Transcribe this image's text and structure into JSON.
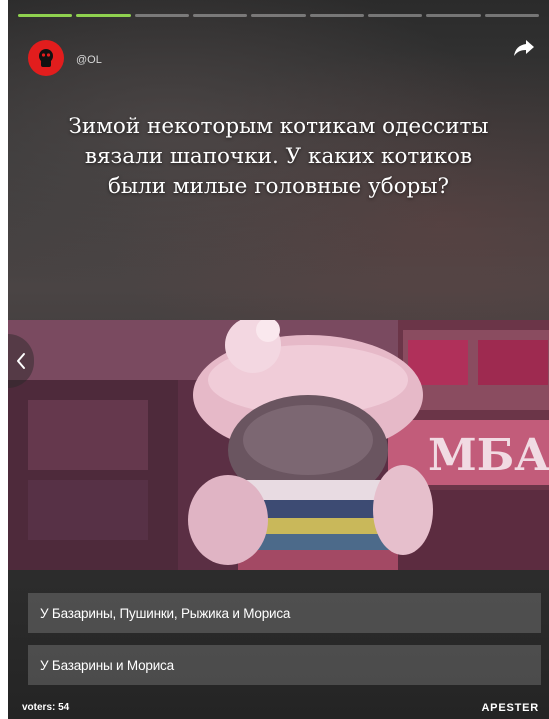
{
  "progress": {
    "segments_total": 9,
    "segments_done": 2
  },
  "author": {
    "handle": "@OL"
  },
  "question": {
    "text": "Зимой некоторым котикам одесситы вязали шапочки. У каких котиков были милые головные уборы?"
  },
  "photo": {
    "shop_sign_text": "МБА"
  },
  "answers": [
    {
      "label": "У Базарины, Пушинки, Рыжика и Мориса"
    },
    {
      "label": "У Базарины и Мориса"
    }
  ],
  "footer": {
    "voters": "voters: 54",
    "brand": "APESTER"
  },
  "colors": {
    "progress_done": "#8fd14f",
    "avatar": "#e21d1d",
    "answer_bg": "rgba(210,210,210,0.22)"
  },
  "icons": {
    "share": "share-arrow-icon",
    "prev": "chevron-left-icon",
    "avatar": "logo-icon"
  }
}
